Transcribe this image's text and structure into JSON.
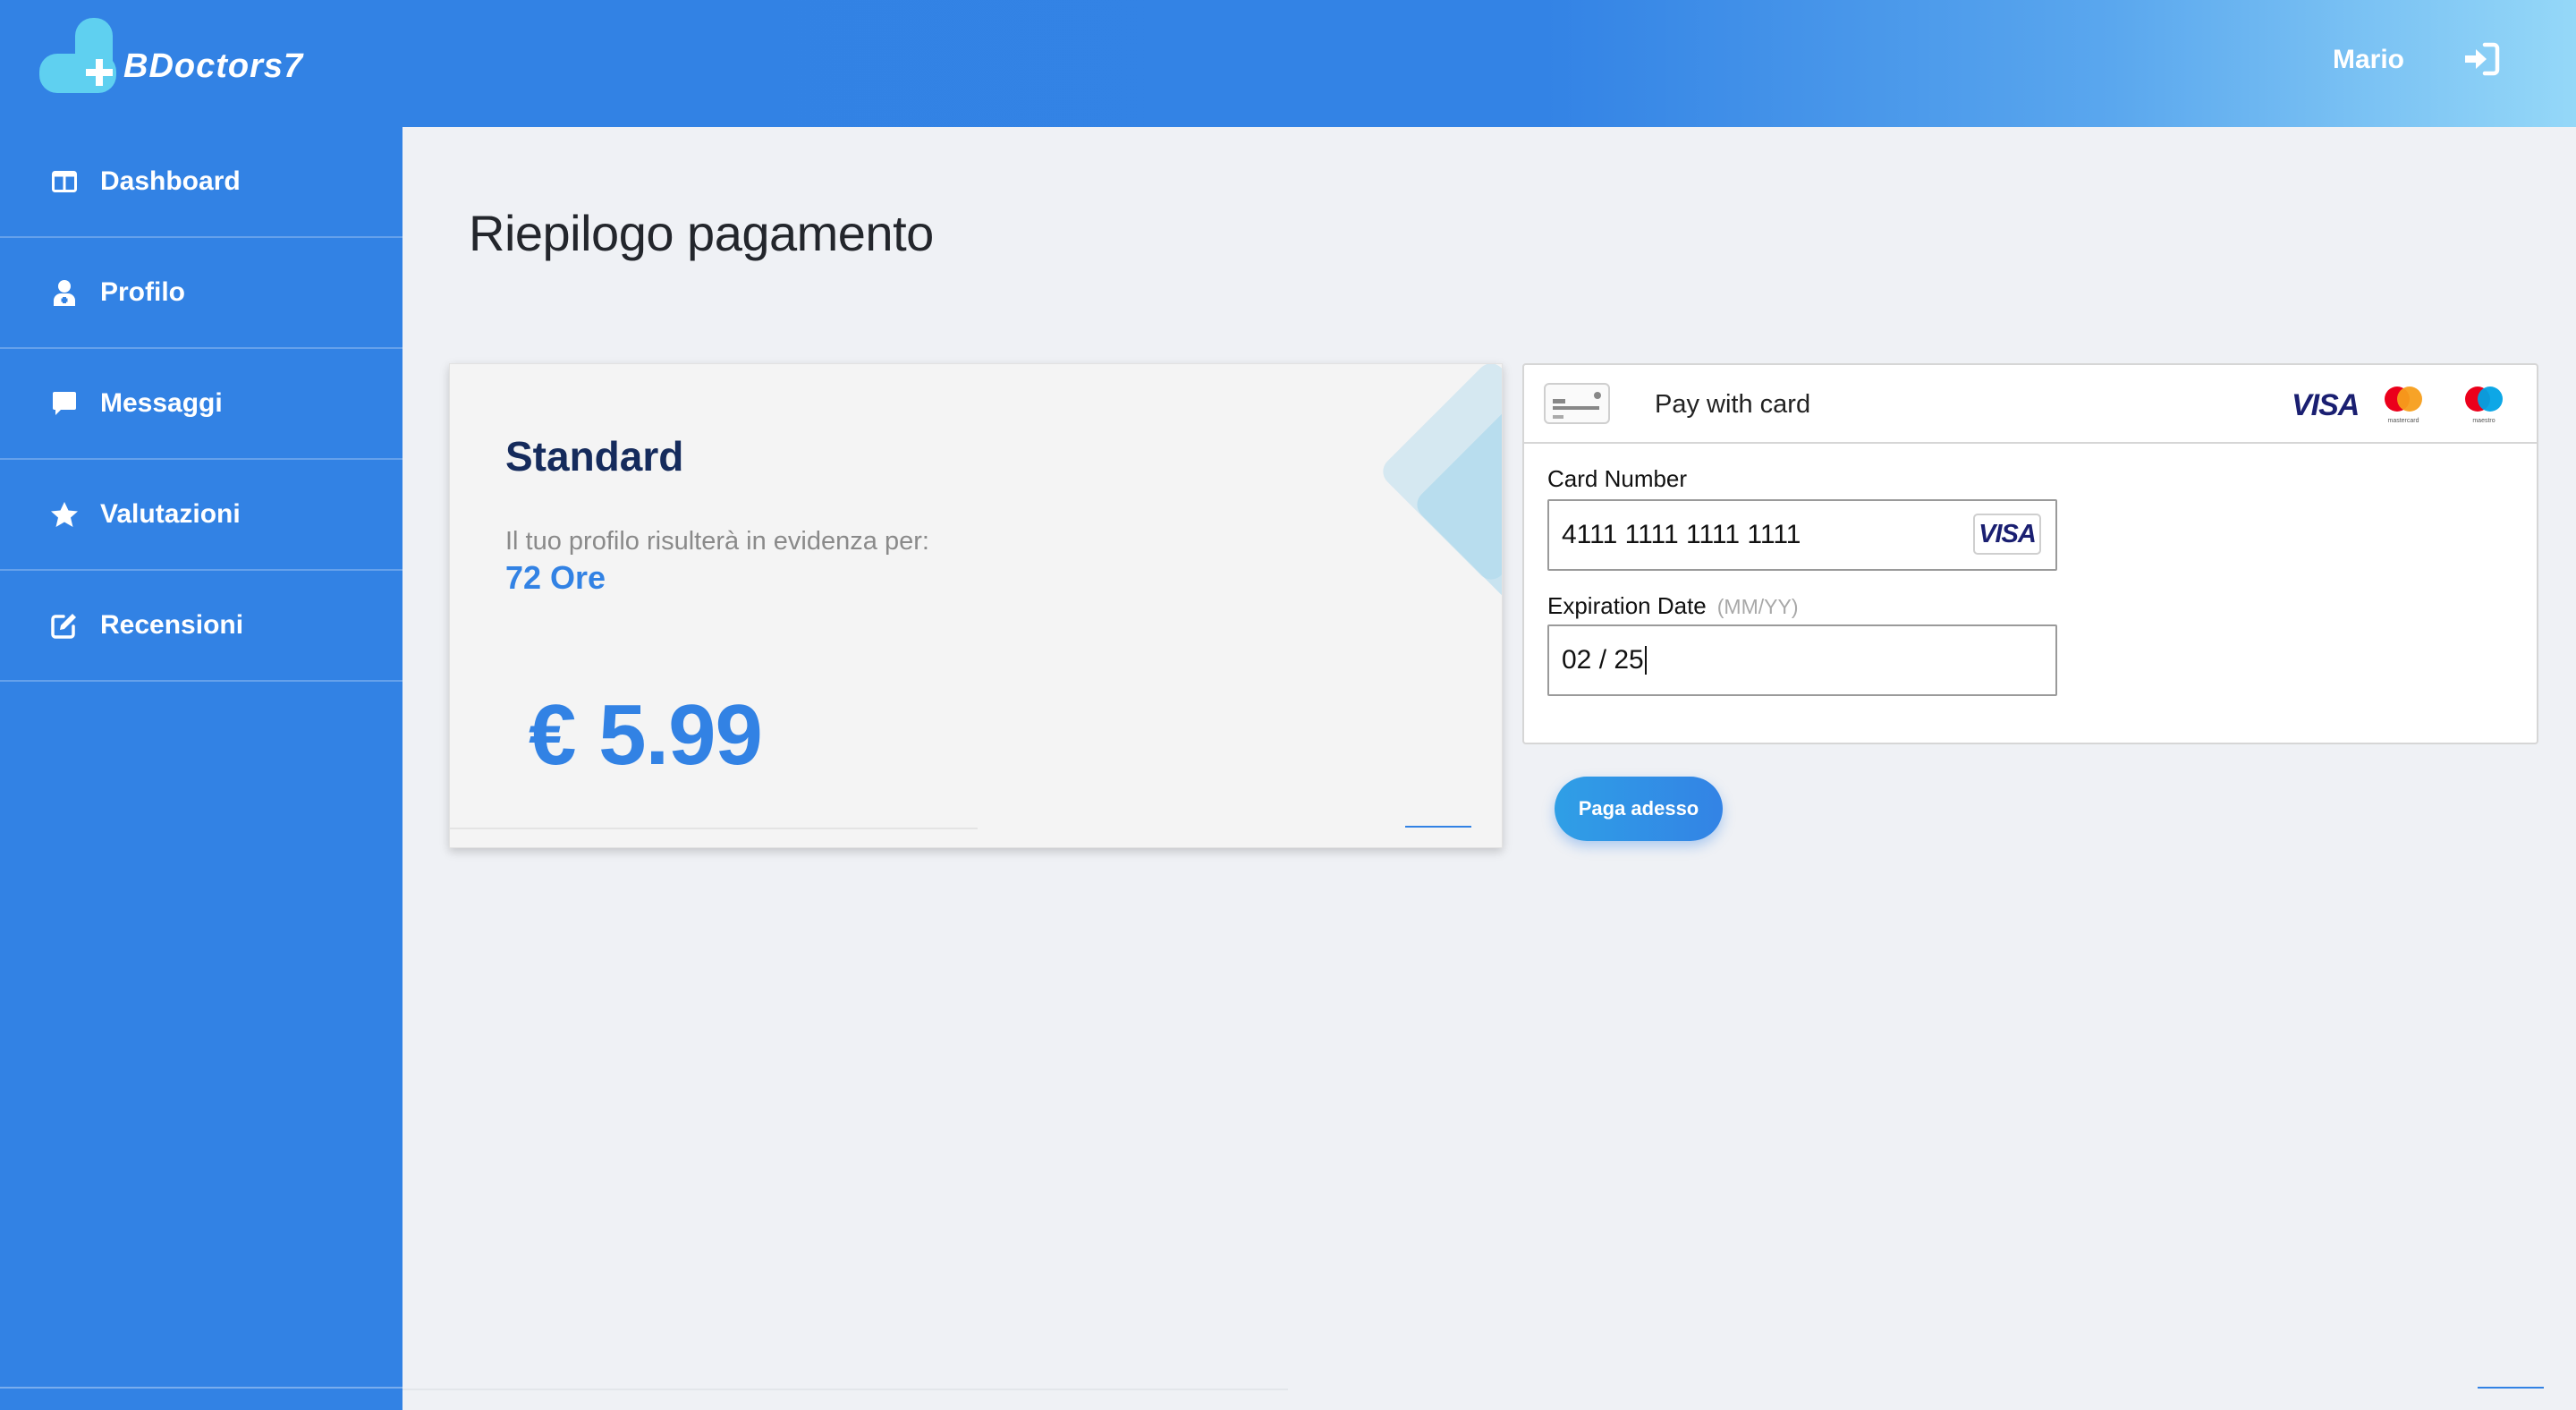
{
  "app": {
    "brand": "BDoctors7"
  },
  "header": {
    "user_name": "Mario"
  },
  "sidebar": {
    "items": [
      {
        "label": "Dashboard",
        "icon": "dashboard-icon"
      },
      {
        "label": "Profilo",
        "icon": "user-doctor-icon"
      },
      {
        "label": "Messaggi",
        "icon": "message-icon"
      },
      {
        "label": "Valutazioni",
        "icon": "star-icon"
      },
      {
        "label": "Recensioni",
        "icon": "edit-icon"
      }
    ]
  },
  "main": {
    "title": "Riepilogo pagamento",
    "plan": {
      "name": "Standard",
      "description": "Il tuo profilo risulterà in evidenza per:",
      "duration": "72 Ore",
      "price": "€ 5.99"
    },
    "payment": {
      "title": "Pay with card",
      "brands": [
        "VISA",
        "mastercard",
        "maestro"
      ],
      "card_number_label": "Card Number",
      "card_number_value": "4111 1111 1111 1111",
      "card_brand_detected": "VISA",
      "expiration_label": "Expiration Date",
      "expiration_hint": "(MM/YY)",
      "expiration_value": "02 / 25"
    },
    "pay_button": "Paga adesso"
  },
  "colors": {
    "primary": "#3282e4",
    "accent_light": "#95d8f8",
    "background": "#eff1f5",
    "plan_title": "#152b5c"
  }
}
